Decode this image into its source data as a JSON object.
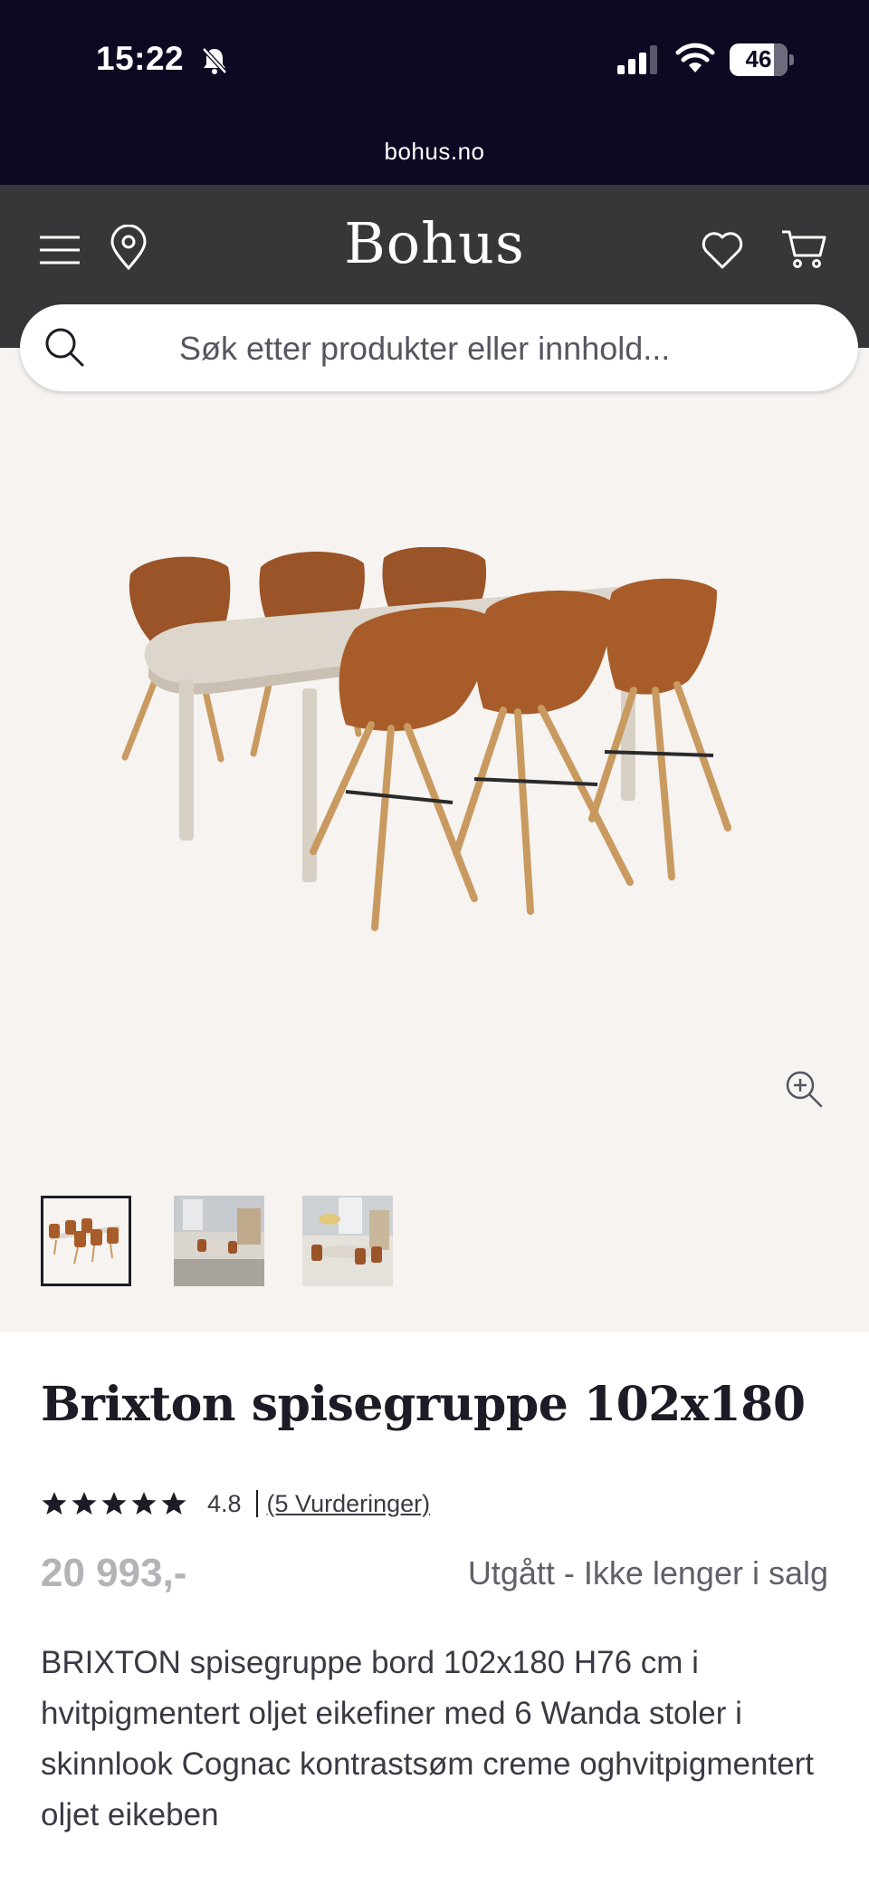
{
  "status_bar": {
    "time": "15:22",
    "battery": "46",
    "icons": [
      "bell-muted-icon",
      "signal-icon",
      "wifi-icon",
      "battery-icon"
    ]
  },
  "browser": {
    "url": "bohus.no"
  },
  "header": {
    "logo": "Bohus",
    "icons": [
      "menu-icon",
      "location-pin-icon",
      "heart-icon",
      "cart-icon"
    ]
  },
  "search": {
    "placeholder": "Søk etter produkter eller innhold..."
  },
  "gallery": {
    "thumbnail_count": 3,
    "active_index": 0
  },
  "product": {
    "title": "Brixton spisegruppe 102x180",
    "rating": "4.8",
    "rating_stars": 5,
    "reviews_link": "(5 Vurderinger)",
    "price": "20 993,-",
    "availability": "Utgått - Ikke lenger i salg",
    "description": "BRIXTON spisegruppe bord 102x180 H76 cm i hvitpigmentert oljet eikefiner med 6 Wanda stoler i skinnlook Cognac kontrastsøm creme oghvitpigmentert oljet eikeben"
  },
  "colors": {
    "status_bg": "#0b0a22",
    "header_bg": "#373739",
    "gallery_bg": "#f6f3f1",
    "chair_leather": "#9a5428",
    "table_top": "#ddd6cc",
    "price_gray": "#b3b3b8"
  }
}
